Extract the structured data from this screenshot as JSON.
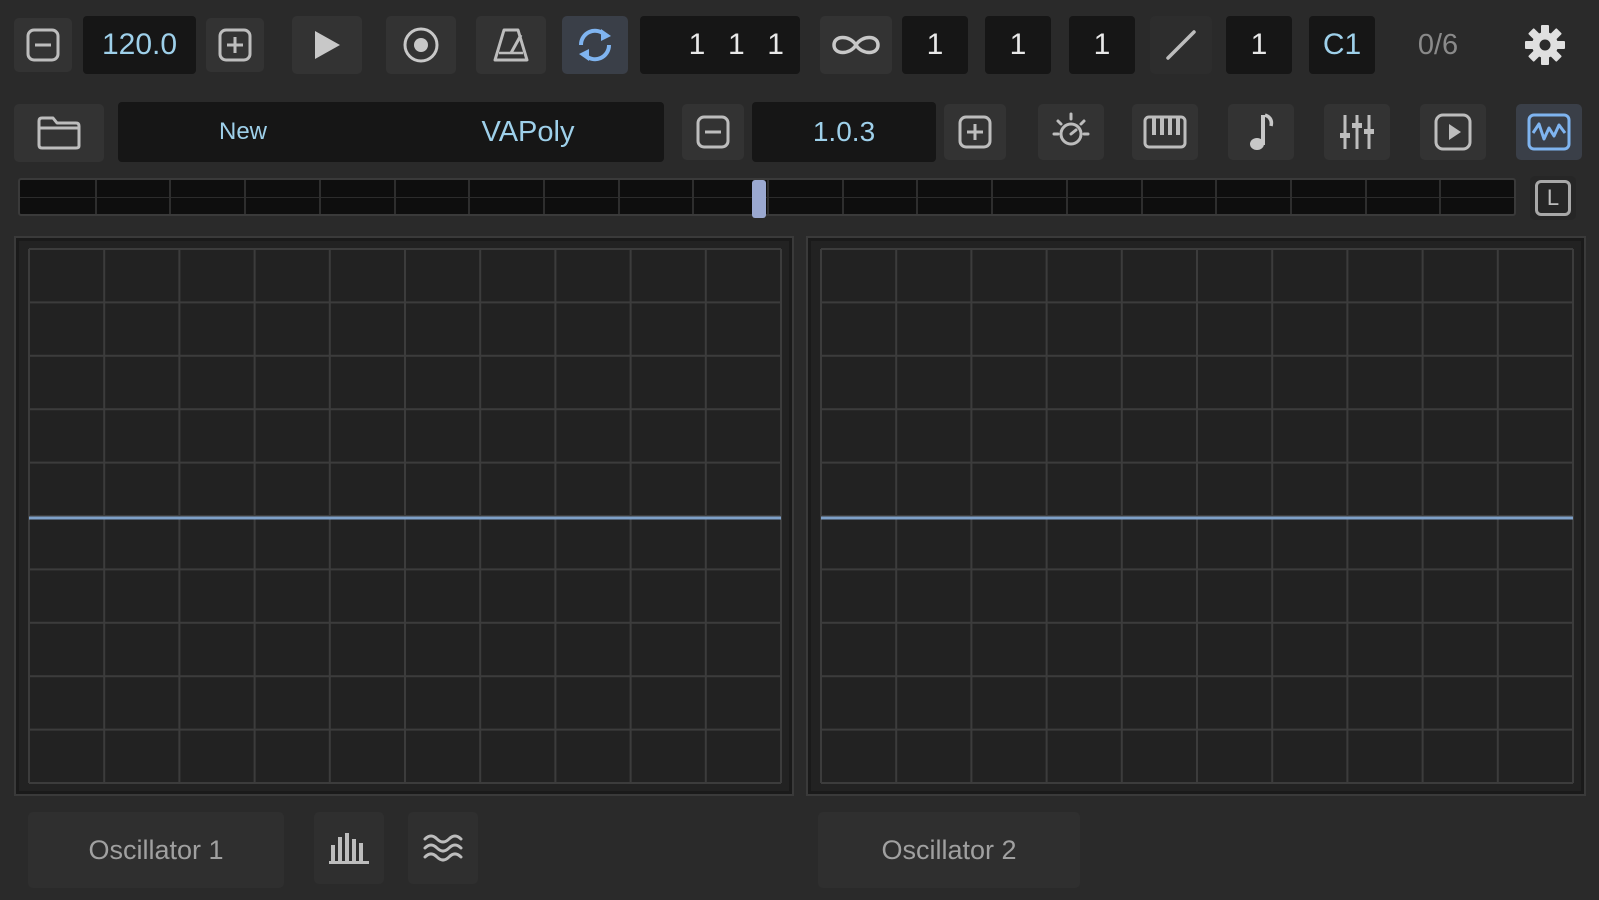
{
  "transport": {
    "tempo_decrease_icon": "minus-square-icon",
    "tempo": "120.0",
    "tempo_increase_icon": "plus-square-icon",
    "play_icon": "play-icon",
    "record_icon": "record-icon",
    "metronome_icon": "metronome-icon",
    "loop_icon": "loop-icon",
    "position": "1  1  1",
    "infinite_icon": "infinity-icon",
    "field_a": "1",
    "field_b": "1",
    "field_c": "1",
    "slash_icon": "slash-icon",
    "field_d": "1",
    "key": "C1",
    "voices": "0/6",
    "settings_icon": "gear-icon"
  },
  "preset_bar": {
    "folder_icon": "folder-icon",
    "preset_name": "New",
    "instrument_name": "VAPoly",
    "version": "1.0.3",
    "icons": [
      "sun-icon",
      "piano-keys-icon",
      "music-note-icon",
      "mixer-sliders-icon",
      "play-square-icon",
      "waveform-icon"
    ],
    "lock_label": "L"
  },
  "progress": {
    "position_fraction": 0.49
  },
  "oscilloscopes": {
    "left_label": "Oscillator 1",
    "right_label": "Oscillator 2",
    "spectrum_icon": "spectrum-bars-icon",
    "waves_icon": "waves-icon"
  },
  "colors": {
    "accent": "#8fb0e0",
    "display_text": "#9ed0ea",
    "background": "#2a2a2a"
  }
}
